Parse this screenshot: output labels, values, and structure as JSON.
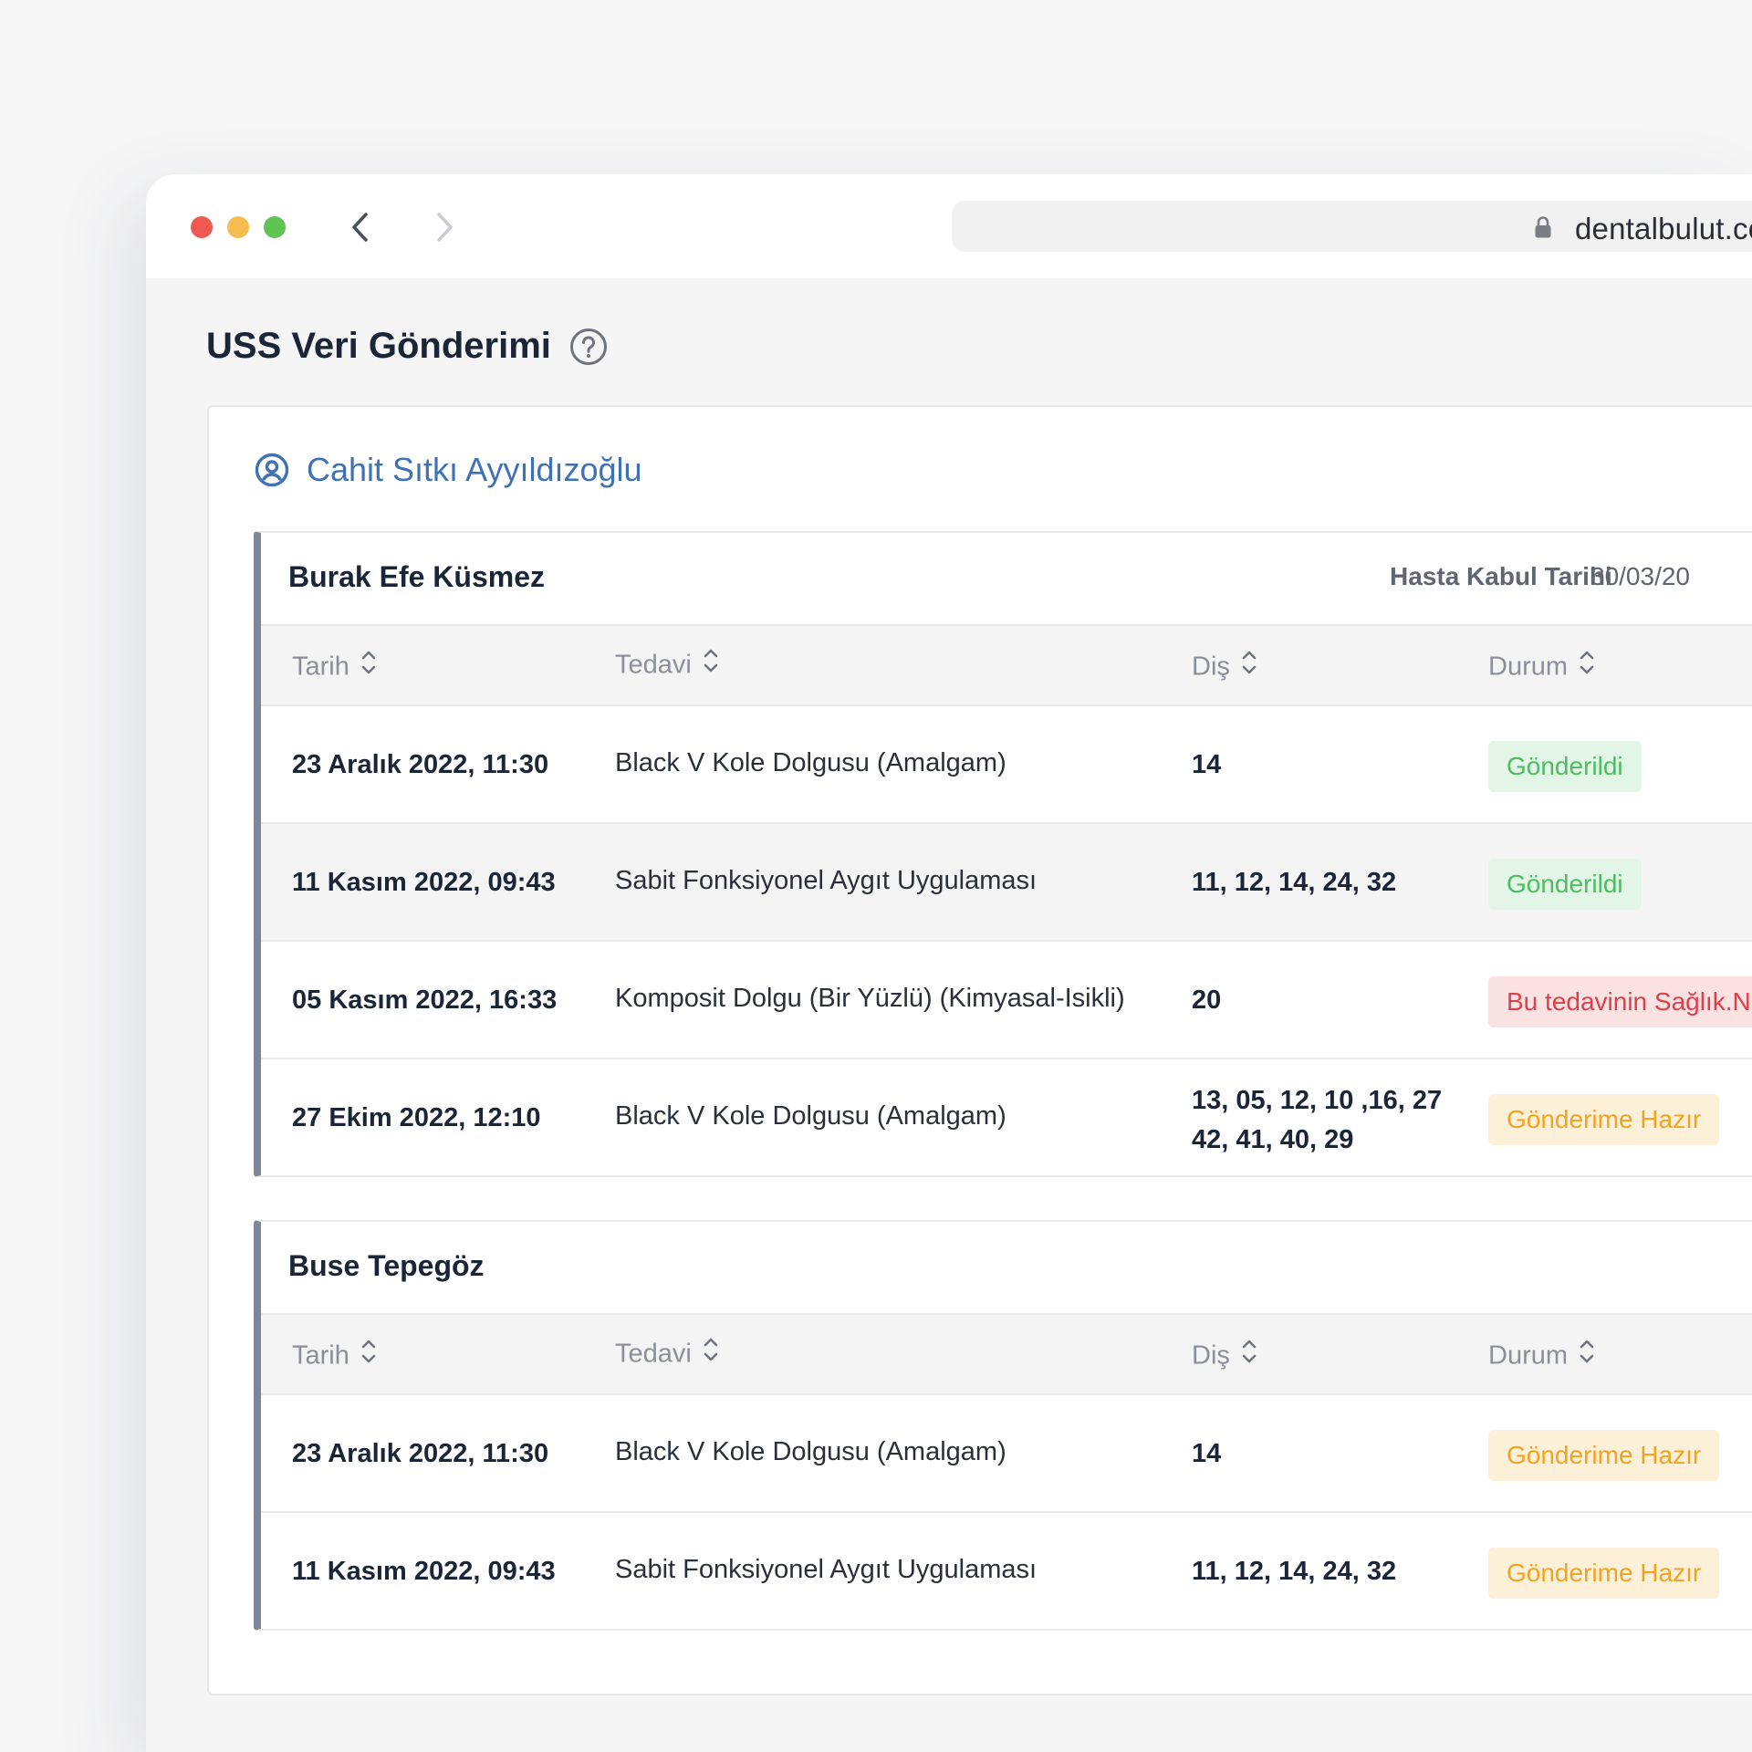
{
  "browser": {
    "url": "dentalbulut.com"
  },
  "page": {
    "title": "USS Veri Gönderimi"
  },
  "doctor": {
    "name": "Cahit Sıtkı Ayyıldızoğlu"
  },
  "table_columns": [
    "Tarih",
    "Tedavi",
    "Diş",
    "Durum"
  ],
  "patients": [
    {
      "name": "Burak Efe Küsmez",
      "kabul_label": "Hasta Kabul Tarihi",
      "kabul_value": "30/03/20",
      "rows": [
        {
          "date": "23 Aralık 2022, 11:30",
          "tedavi": "Black V Kole Dolgusu (Amalgam)",
          "dis": "14",
          "durum": "Gönderildi",
          "status": "sent"
        },
        {
          "date": "11 Kasım 2022, 09:43",
          "tedavi": "Sabit Fonksiyonel Aygıt Uygulaması",
          "dis": "11, 12, 14, 24, 32",
          "durum": "Gönderildi",
          "status": "sent"
        },
        {
          "date": "05 Kasım 2022, 16:33",
          "tedavi": "Komposit Dolgu (Bir Yüzlü) (Kimyasal-Isikli)",
          "dis": "20",
          "durum": "Bu tedavinin Sağlık.N",
          "status": "error"
        },
        {
          "date": "27 Ekim 2022, 12:10",
          "tedavi": "Black V Kole Dolgusu (Amalgam)",
          "dis": "13, 05, 12, 10 ,16, 27",
          "dis2": "42, 41, 40, 29",
          "durum": "Gönderime Hazır",
          "status": "ready"
        }
      ]
    },
    {
      "name": "Buse Tepegöz",
      "rows": [
        {
          "date": "23 Aralık 2022, 11:30",
          "tedavi": "Black V Kole Dolgusu (Amalgam)",
          "dis": "14",
          "durum": "Gönderime Hazır",
          "status": "ready"
        },
        {
          "date": "11 Kasım 2022, 09:43",
          "tedavi": "Sabit Fonksiyonel Aygıt Uygulaması",
          "dis": "11, 12, 14, 24, 32",
          "durum": "Gönderime Hazır",
          "status": "ready"
        }
      ]
    }
  ],
  "colors": {
    "accent": "#3f72b5",
    "sent": "#4dbd62",
    "ready": "#f1a321",
    "error": "#df3f48"
  }
}
